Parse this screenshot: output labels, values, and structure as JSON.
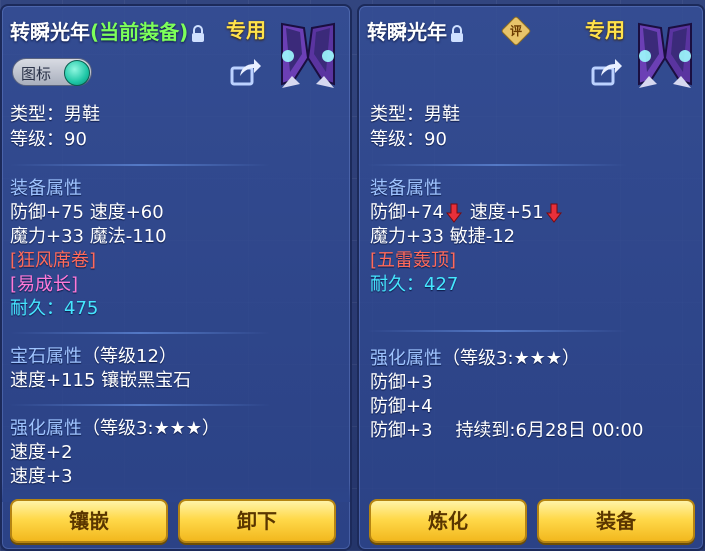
{
  "left": {
    "title": "转瞬光年",
    "equipped_tag": "(当前装备)",
    "special_tag": "专用",
    "toggle_label": "图标",
    "type_line": "类型：男鞋",
    "level_line": "等级：90",
    "equip_attr_header": "装备属性",
    "stat_line1": "防御+75 速度+60",
    "stat_line2": "魔力+33 魔法-110",
    "special_effect": "[狂风席卷]",
    "set_effect": "[易成长]",
    "durability_label": "耐久：",
    "durability_value": "475",
    "gem_header": "宝石属性",
    "gem_level": "（等级12）",
    "gem_line": "速度+115 镶嵌黑宝石",
    "enhance_header": "强化属性",
    "enhance_level": "（等级3:★★★）",
    "enhance_line1": "速度+2",
    "enhance_line2": "速度+3",
    "btn_inlay": "镶嵌",
    "btn_unequip": "卸下"
  },
  "right": {
    "title": "转瞬光年",
    "review_badge": "评",
    "special_tag": "专用",
    "type_line": "类型：男鞋",
    "level_line": "等级：90",
    "equip_attr_header": "装备属性",
    "stat1a": "防御+74",
    "stat1b": "速度+51",
    "stat_line2": "魔力+33 敏捷-12",
    "special_effect": "[五雷轰顶]",
    "durability_label": "耐久：",
    "durability_value": "427",
    "enhance_header": "强化属性",
    "enhance_level": "（等级3:★★★）",
    "enhance_line1": "防御+3",
    "enhance_line2": "防御+4",
    "enhance_line3a": "防御+3",
    "enhance_line3b": "持续到:6月28日 00:00",
    "btn_refine": "炼化",
    "btn_equip": "装备"
  },
  "colors": {
    "panel": "#2c448a",
    "header_text": "#9fc4ff",
    "equipped": "#7dff5a",
    "special": "#ffe24a",
    "effect_red": "#ff6a5a",
    "effect_pink": "#ff7ad8",
    "durability": "#46e7ff",
    "button": "#ffd94a"
  },
  "icons": [
    "lock-icon",
    "review-icon",
    "share-icon",
    "boots-item-icon",
    "down-arrow-icon",
    "toggle-knob"
  ]
}
